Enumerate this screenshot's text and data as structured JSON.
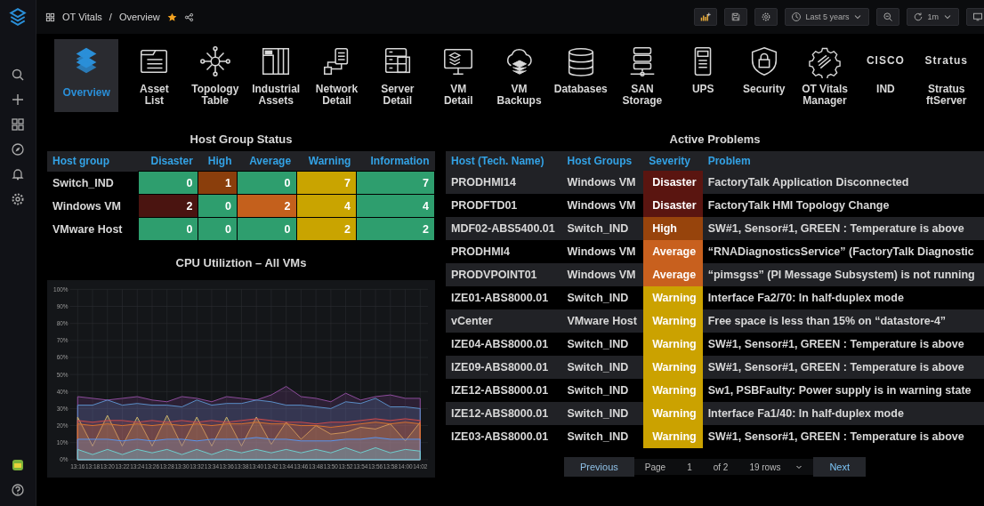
{
  "breadcrumb": {
    "folder": "OT Vitals",
    "separator": "/",
    "title": "Overview",
    "starred": true
  },
  "toolbar": {
    "time_range": "Last 5 years",
    "refresh": "1m"
  },
  "nav": [
    {
      "label": "Overview",
      "selected": true
    },
    {
      "label": "Asset\nList",
      "selected": false
    },
    {
      "label": "Topology\nTable",
      "selected": false
    },
    {
      "label": "Industrial\nAssets",
      "selected": false
    },
    {
      "label": "Network\nDetail",
      "selected": false
    },
    {
      "label": "Server\nDetail",
      "selected": false
    },
    {
      "label": "VM\nDetail",
      "selected": false
    },
    {
      "label": "VM\nBackups",
      "selected": false
    },
    {
      "label": "Databases",
      "selected": false
    },
    {
      "label": "SAN\nStorage",
      "selected": false
    },
    {
      "label": "UPS",
      "selected": false
    },
    {
      "label": "Security",
      "selected": false
    },
    {
      "label": "OT Vitals\nManager",
      "selected": false
    },
    {
      "label": "IND",
      "selected": false,
      "logo_text": "CISCO"
    },
    {
      "label": "Stratus\nftServer",
      "selected": false,
      "logo_text": "Stratus"
    }
  ],
  "host_group_status": {
    "title": "Host Group Status",
    "columns": [
      "Host group",
      "Disaster",
      "High",
      "Average",
      "Warning",
      "Information"
    ],
    "rows": [
      {
        "cells": [
          {
            "value": "Switch_IND"
          },
          {
            "value": "0",
            "color": "#2e9e6e"
          },
          {
            "value": "1",
            "color": "#8a3e0c"
          },
          {
            "value": "0",
            "color": "#2e9e6e"
          },
          {
            "value": "7",
            "color": "#c9a400"
          },
          {
            "value": "7",
            "color": "#2e9e6e"
          }
        ]
      },
      {
        "cells": [
          {
            "value": "Windows VM"
          },
          {
            "value": "2",
            "color": "#4a1410"
          },
          {
            "value": "0",
            "color": "#2e9e6e"
          },
          {
            "value": "2",
            "color": "#c4601c"
          },
          {
            "value": "4",
            "color": "#c9a400"
          },
          {
            "value": "4",
            "color": "#2e9e6e"
          }
        ]
      },
      {
        "cells": [
          {
            "value": "VMware Host"
          },
          {
            "value": "0",
            "color": "#2e9e6e"
          },
          {
            "value": "0",
            "color": "#2e9e6e"
          },
          {
            "value": "0",
            "color": "#2e9e6e"
          },
          {
            "value": "2",
            "color": "#c9a400"
          },
          {
            "value": "2",
            "color": "#2e9e6e"
          }
        ]
      }
    ]
  },
  "cpu_panel": {
    "title": "CPU Utiliztion – All VMs",
    "chart_data": {
      "type": "area",
      "grid": true,
      "ylim": [
        0,
        100
      ],
      "yticks": [
        {
          "value": 0,
          "label": "0%"
        },
        {
          "value": 10,
          "label": "10%"
        },
        {
          "value": 20,
          "label": "20%"
        },
        {
          "value": 30,
          "label": "30%"
        },
        {
          "value": 40,
          "label": "40%"
        },
        {
          "value": 50,
          "label": "50%"
        },
        {
          "value": 60,
          "label": "60%"
        },
        {
          "value": 70,
          "label": "70%"
        },
        {
          "value": 80,
          "label": "80%"
        },
        {
          "value": 90,
          "label": "90%"
        },
        {
          "value": 100,
          "label": "100%"
        }
      ],
      "x": [
        "13:16",
        "13:18",
        "13:20",
        "13:22",
        "13:24",
        "13:26",
        "13:28",
        "13:30",
        "13:32",
        "13:34",
        "13:36",
        "13:38",
        "13:40",
        "13:42",
        "13:44",
        "13:46",
        "13:48",
        "13:50",
        "13:52",
        "13:54",
        "13:56",
        "13:58",
        "14:00",
        "14:02"
      ],
      "series": [
        {
          "color": "#8e4d9e",
          "values": [
            37,
            36,
            35,
            36,
            37,
            35,
            34,
            37,
            36,
            34,
            37,
            36,
            35,
            38,
            43,
            37,
            36,
            34,
            39,
            35,
            37,
            38,
            36,
            36
          ]
        },
        {
          "color": "#5b8fc9",
          "values": [
            32,
            32,
            35,
            32,
            33,
            32,
            32,
            31,
            35,
            32,
            33,
            33,
            35,
            34,
            32,
            32,
            31,
            30,
            34,
            33,
            36,
            31,
            31,
            30
          ]
        },
        {
          "color": "#c9b16c",
          "values": [
            25,
            8,
            26,
            8,
            25,
            8,
            26,
            8,
            25,
            8,
            25,
            8,
            25,
            9,
            22,
            12,
            20,
            15,
            16,
            19,
            18,
            21,
            11,
            22
          ]
        },
        {
          "color": "#d04b4b",
          "values": [
            23,
            22,
            23,
            23,
            22,
            23,
            22,
            23,
            22,
            23,
            22,
            23,
            24,
            23,
            22,
            22,
            21,
            22,
            22,
            23,
            24,
            23,
            24,
            23
          ]
        },
        {
          "color": "#d8742e",
          "values": [
            21,
            20,
            21,
            20,
            21,
            20,
            21,
            20,
            21,
            20,
            21,
            21,
            22,
            21,
            21,
            20,
            20,
            19,
            20,
            21,
            22,
            21,
            22,
            21
          ]
        },
        {
          "color": "#5794f2",
          "values": [
            12,
            12,
            12,
            11,
            12,
            11,
            12,
            12,
            11,
            12,
            12,
            12,
            13,
            12,
            12,
            11,
            11,
            11,
            12,
            12,
            13,
            12,
            12,
            12
          ]
        },
        {
          "color": "#6fd0d0",
          "values": [
            6,
            3,
            6,
            3,
            6,
            4,
            6,
            3,
            6,
            3,
            6,
            4,
            6,
            4,
            6,
            4,
            6,
            4,
            7,
            4,
            7,
            4,
            6,
            5
          ]
        }
      ]
    }
  },
  "active_problems": {
    "title": "Active Problems",
    "columns": [
      "Host (Tech. Name)",
      "Host Groups",
      "Severity",
      "Problem"
    ],
    "rows": [
      {
        "host": "PRODHMI14",
        "group": "Windows VM",
        "severity": "Disaster",
        "color": "#5a1510",
        "problem": "FactoryTalk Application Disconnected"
      },
      {
        "host": "PRODFTD01",
        "group": "Windows VM",
        "severity": "Disaster",
        "color": "#5a1510",
        "problem": "FactoryTalk HMI Topology Change"
      },
      {
        "host": "MDF02-ABS5400.01",
        "group": "Switch_IND",
        "severity": "High",
        "color": "#97440c",
        "problem": "SW#1, Sensor#1, GREEN : Temperature is above"
      },
      {
        "host": "PRODHMI4",
        "group": "Windows VM",
        "severity": "Average",
        "color": "#c8601e",
        "problem": "“RNADiagnosticsService” (FactoryTalk Diagnostic"
      },
      {
        "host": "PRODVPOINT01",
        "group": "Windows VM",
        "severity": "Average",
        "color": "#c8601e",
        "problem": "“pimsgss” (PI Message Subsystem) is not running"
      },
      {
        "host": "IZE01-ABS8000.01",
        "group": "Switch_IND",
        "severity": "Warning",
        "color": "#cba200",
        "problem": "Interface Fa2/70: In half-duplex mode"
      },
      {
        "host": "vCenter",
        "group": "VMware Host",
        "severity": "Warning",
        "color": "#cba200",
        "problem": "Free space is less than 15% on “datastore-4”"
      },
      {
        "host": "IZE04-ABS8000.01",
        "group": "Switch_IND",
        "severity": "Warning",
        "color": "#cba200",
        "problem": "SW#1, Sensor#1, GREEN : Temperature is above"
      },
      {
        "host": "IZE09-ABS8000.01",
        "group": "Switch_IND",
        "severity": "Warning",
        "color": "#cba200",
        "problem": "SW#1, Sensor#1, GREEN : Temperature is above"
      },
      {
        "host": "IZE12-ABS8000.01",
        "group": "Switch_IND",
        "severity": "Warning",
        "color": "#cba200",
        "problem": "Sw1, PSBFaulty: Power supply is in warning state"
      },
      {
        "host": "IZE12-ABS8000.01",
        "group": "Switch_IND",
        "severity": "Warning",
        "color": "#cba200",
        "problem": "Interface Fa1/40: In half-duplex mode"
      },
      {
        "host": "IZE03-ABS8000.01",
        "group": "Switch_IND",
        "severity": "Warning",
        "color": "#cba200",
        "problem": "SW#1, Sensor#1, GREEN : Temperature is above"
      }
    ],
    "pagination": {
      "previous": "Previous",
      "page_label": "Page",
      "page": "1",
      "of": "of 2",
      "rows": "19 rows",
      "next": "Next"
    }
  }
}
